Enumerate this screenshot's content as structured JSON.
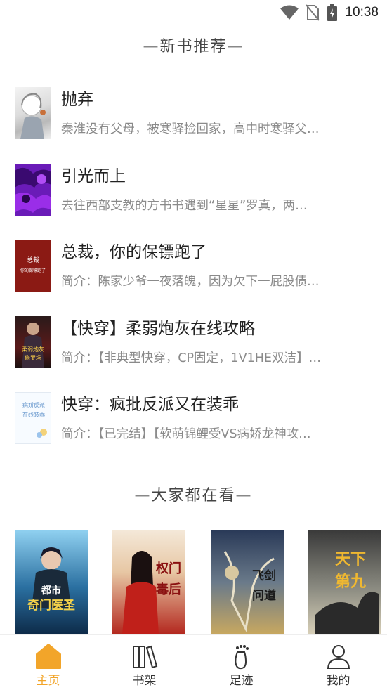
{
  "status_bar": {
    "time": "10:38"
  },
  "new_books": {
    "heading": "新书推荐",
    "items": [
      {
        "title": "抛弃",
        "desc": "秦淮没有父母，被寒驿捡回家，高中时寒驿父…"
      },
      {
        "title": "引光而上",
        "desc": "去往西部支教的方书书遇到“星星”罗真，两…"
      },
      {
        "title": "总裁，你的保镖跑了",
        "desc": "简介：陈家少爷一夜落魄，因为欠下一屁股债…",
        "cover_text": "总裁\n你的保镖跑了"
      },
      {
        "title": "【快穿】柔弱炮灰在线攻略",
        "desc": "简介：【非典型快穿，CP固定，1V1HE双洁】…",
        "cover_text": "柔弱炮灰\n修罗场"
      },
      {
        "title": "快穿：疯批反派又在装乖",
        "desc": "简介：【已完结】【软萌锦鲤受VS病娇龙神攻…",
        "cover_text": "病娇反派\n在线装乖"
      }
    ]
  },
  "popular": {
    "heading": "大家都在看",
    "covers": [
      {
        "cover_text": "都市\n奇门医圣"
      },
      {
        "cover_text": "权门毒后"
      },
      {
        "cover_text": "飞剑问道"
      },
      {
        "cover_text": "天下第九"
      }
    ]
  },
  "tabs": [
    {
      "label": "主页",
      "icon": "home-icon",
      "active": true
    },
    {
      "label": "书架",
      "icon": "bookshelf-icon",
      "active": false
    },
    {
      "label": "足迹",
      "icon": "footprint-icon",
      "active": false
    },
    {
      "label": "我的",
      "icon": "profile-icon",
      "active": false
    }
  ],
  "colors": {
    "accent": "#f2a52a",
    "desc_text": "#8a8a8a",
    "title_text": "#222222"
  }
}
